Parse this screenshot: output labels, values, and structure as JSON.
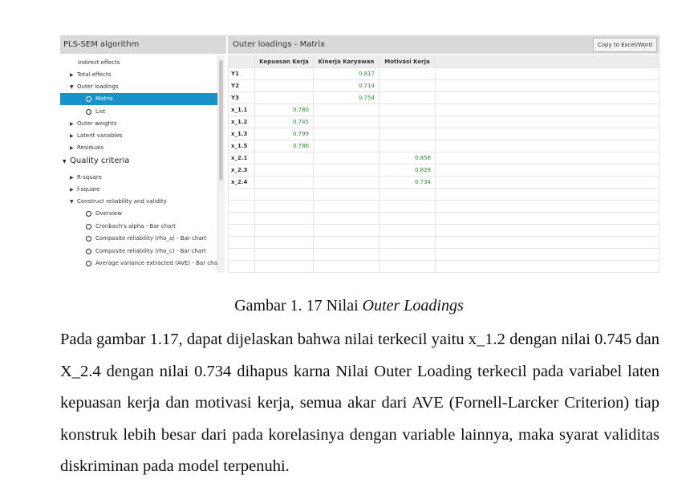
{
  "left_panel": {
    "title": "PLS-SEM algorithm",
    "items": [
      {
        "label": "Indirect effects",
        "type": "leaf"
      },
      {
        "label": "Total effects",
        "type": "collapsed"
      },
      {
        "label": "Outer loadings",
        "type": "expanded"
      },
      {
        "label": "Matrix",
        "type": "radio",
        "selected": true
      },
      {
        "label": "List",
        "type": "radio"
      },
      {
        "label": "Outer weights",
        "type": "collapsed"
      },
      {
        "label": "Latent variables",
        "type": "collapsed"
      },
      {
        "label": "Residuals",
        "type": "collapsed"
      },
      {
        "label": "Quality criteria",
        "type": "section"
      },
      {
        "label": "R-square",
        "type": "collapsed"
      },
      {
        "label": "f-square",
        "type": "collapsed"
      },
      {
        "label": "Construct reliability and validity",
        "type": "expanded"
      },
      {
        "label": "Overview",
        "type": "radio"
      },
      {
        "label": "Cronbach's alpha - Bar chart",
        "type": "radio"
      },
      {
        "label": "Composite reliability (rho_a) - Bar chart",
        "type": "radio"
      },
      {
        "label": "Composite reliability (rho_c) - Bar chart",
        "type": "radio"
      },
      {
        "label": "Average variance extracted (AVE) - Bar chart",
        "type": "radio"
      }
    ]
  },
  "right_panel": {
    "title": "Outer loadings - Matrix",
    "copy_button": "Copy to Excel/Word",
    "columns": [
      "Kepuasan Kerja",
      "Kinerja Karyawan",
      "Motivasi Kerja"
    ],
    "rows": [
      {
        "label": "Y1",
        "values": [
          "",
          "0.817",
          ""
        ]
      },
      {
        "label": "Y2",
        "values": [
          "",
          "0.714",
          ""
        ]
      },
      {
        "label": "Y3",
        "values": [
          "",
          "0.754",
          ""
        ]
      },
      {
        "label": "x_1.1",
        "values": [
          "0.780",
          "",
          ""
        ]
      },
      {
        "label": "x_1.2",
        "values": [
          "0.745",
          "",
          ""
        ]
      },
      {
        "label": "x_1.3",
        "values": [
          "0.799",
          "",
          ""
        ]
      },
      {
        "label": "x_1.5",
        "values": [
          "0.786",
          "",
          ""
        ]
      },
      {
        "label": "x_2.1",
        "values": [
          "",
          "",
          "0.856"
        ]
      },
      {
        "label": "x_2.3",
        "values": [
          "",
          "",
          "0.829"
        ]
      },
      {
        "label": "x_2.4",
        "values": [
          "",
          "",
          "0.734"
        ]
      }
    ]
  },
  "caption": {
    "prefix": "Gambar 1.  17 Nilai ",
    "italic": "Outer Loadings"
  },
  "paragraph": "Pada gambar 1.17, dapat dijelaskan bahwa nilai terkecil yaitu x_1.2 dengan nilai 0.745 dan X_2.4 dengan nilai 0.734 dihapus karna Nilai Outer Loading terkecil pada variabel laten kepuasan kerja dan motivasi kerja, semua akar dari AVE (Fornell-Larcker Criterion) tiap konstruk lebih besar dari pada korelasinya dengan variable lainnya, maka syarat validitas diskriminan pada model terpenuhi."
}
